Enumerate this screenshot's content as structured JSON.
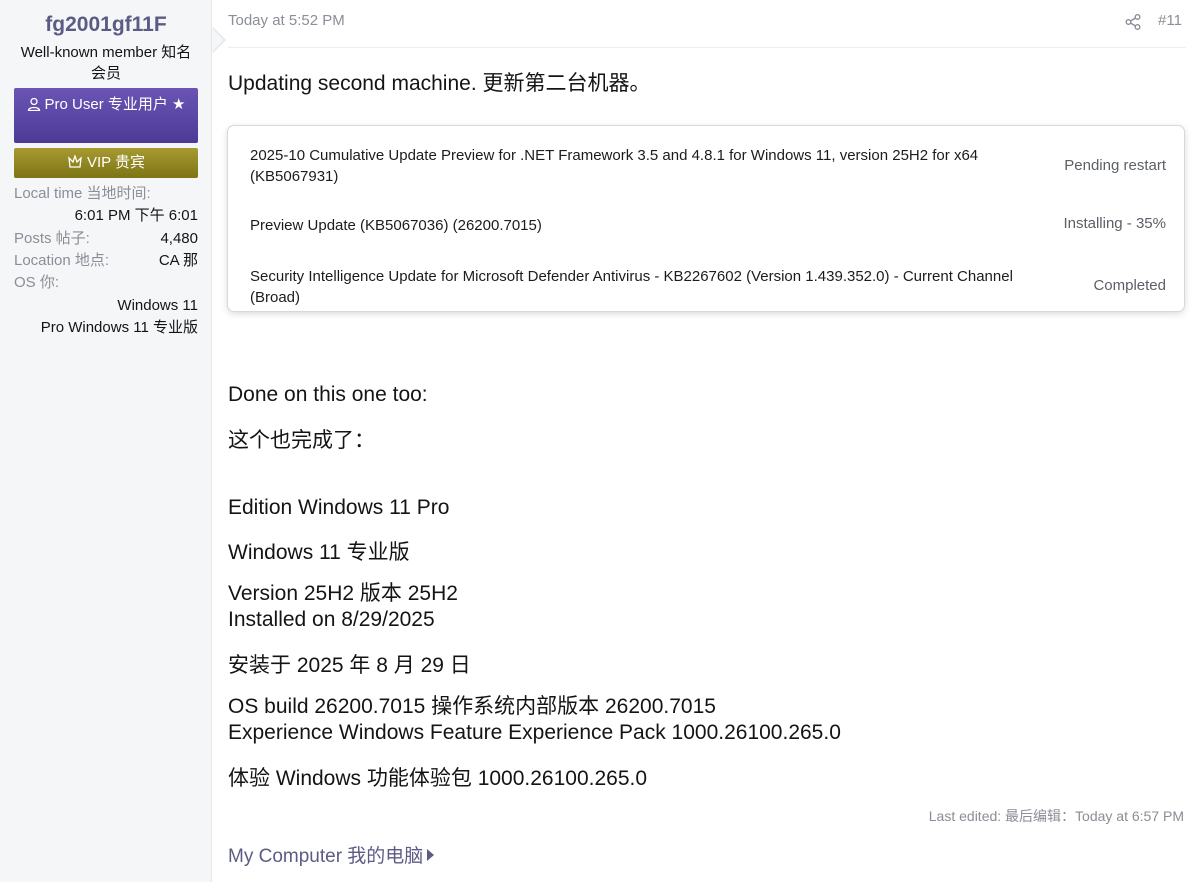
{
  "sidebar": {
    "username": "fg2001gf11F",
    "user_title": "Well-known member 知名会员",
    "banner_pro": "Pro User 专业用户 ★",
    "banner_vip": "VIP 贵宾",
    "local_time_label": "Local time 当地时间:",
    "local_time_value": "6:01 PM 下午 6:01",
    "posts_label": "Posts 帖子:",
    "posts_value": "4,480",
    "location_label": "Location 地点:",
    "location_value": "CA 那",
    "os_label": "OS 你:",
    "os_value_1": "Windows 11",
    "os_value_2": "Pro Windows 11 专业版"
  },
  "post": {
    "date": "Today at 5:52 PM",
    "number": "#11",
    "intro": "Updating second machine. 更新第二台机器。",
    "updates": [
      {
        "name": "2025-10 Cumulative Update Preview for .NET Framework 3.5 and 4.8.1 for Windows 11, version 25H2 for x64 (KB5067931)",
        "status": "Pending restart"
      },
      {
        "name": "Preview Update (KB5067036) (26200.7015)",
        "status": "Installing - 35%"
      },
      {
        "name": "Security Intelligence Update for Microsoft Defender Antivirus - KB2267602 (Version 1.439.352.0) - Current Channel (Broad)",
        "status": "Completed"
      }
    ],
    "lines": [
      "Done on this one too:",
      "这个也完成了：",
      "Edition Windows 11 Pro",
      "Windows 11 专业版",
      "Version 25H2 版本 25H2",
      "Installed on 8/29/2025",
      "安装于 2025 年 8 月 29 日",
      "OS build 26200.7015 操作系统内部版本 26200.7015",
      "Experience Windows Feature Experience Pack 1000.26100.265.0",
      "体验 Windows 功能体验包 1000.26100.265.0"
    ],
    "last_edited": "Last edited: 最后编辑：Today at 6:57 PM",
    "my_computer": "My Computer 我的电脑"
  },
  "icons": {
    "share": "share-icon",
    "user": "user-icon",
    "vip": "crown-icon",
    "caret": "caret-right-icon"
  },
  "colors": {
    "username": "#5c5b84",
    "pro_banner": "#5a46a6",
    "vip_banner": "#958824",
    "muted": "#8a8e96"
  }
}
